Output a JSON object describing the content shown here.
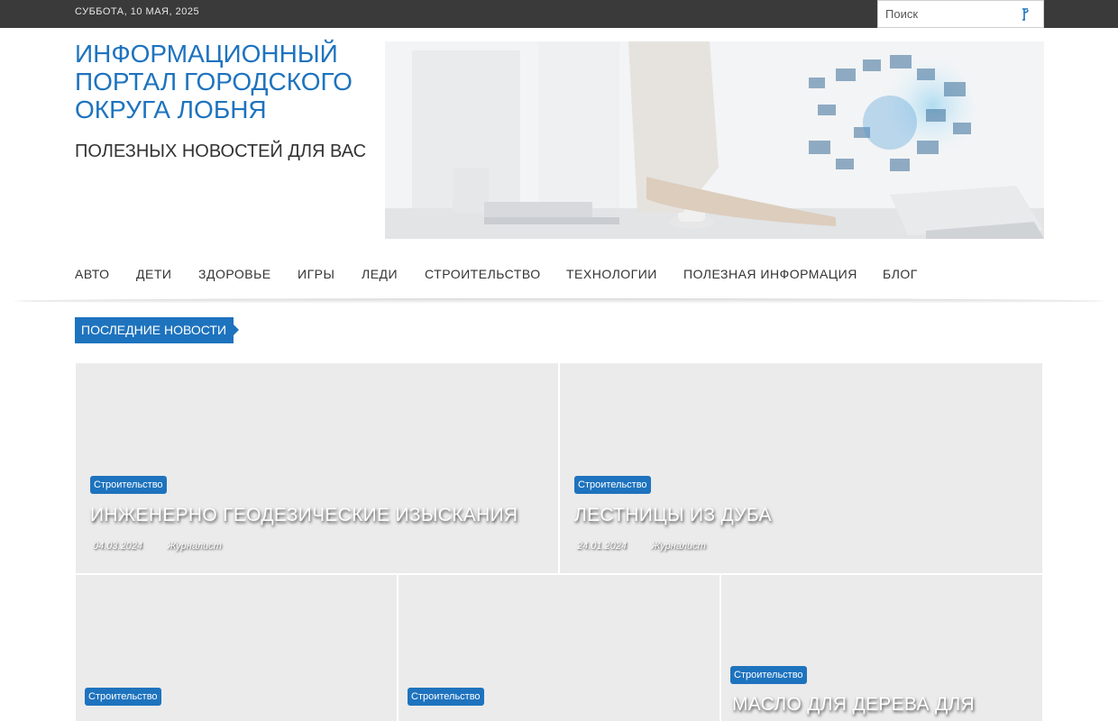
{
  "topbar": {
    "date": "СУББОТА, 10 МАЯ, 2025",
    "search_placeholder": "Поиск",
    "search_icon": "search-icon"
  },
  "header": {
    "title": "ИНФОРМАЦИОННЫЙ ПОРТАЛ ГОРОДСКОГО ОКРУГА ЛОБНЯ",
    "description": "ПОЛЕЗНЫХ НОВОСТЕЙ ДЛЯ ВАС"
  },
  "nav": {
    "items": [
      "АВТО",
      "ДЕТИ",
      "ЗДОРОВЬЕ",
      "ИГРЫ",
      "ЛЕДИ",
      "СТРОИТЕЛЬСТВО",
      "ТЕХНОЛОГИИ",
      "ПОЛЕЗНАЯ ИНФОРМАЦИЯ",
      "БЛОГ"
    ]
  },
  "latest_label": "ПОСЛЕДНИЕ НОВОСТИ",
  "posts": [
    {
      "category": "Строительство",
      "title": "ИНЖЕНЕРНО ГЕОДЕЗИЧЕСКИЕ ИЗЫСКАНИЯ",
      "date": "04.03.2024",
      "author": "Журналист"
    },
    {
      "category": "Строительство",
      "title": "ЛЕСТНИЦЫ ИЗ ДУБА",
      "date": "24.01.2024",
      "author": "Журналист"
    },
    {
      "category": "Строительство",
      "title": "",
      "date": "",
      "author": ""
    },
    {
      "category": "Строительство",
      "title": "",
      "date": "",
      "author": ""
    },
    {
      "category": "Строительство",
      "title": "МАСЛО ДЛЯ ДЕРЕВА ДЛЯ",
      "date": "",
      "author": ""
    }
  ],
  "colors": {
    "accent": "#1e73be",
    "topbar": "#3a3a3a",
    "card_bg": "#ebebeb"
  }
}
